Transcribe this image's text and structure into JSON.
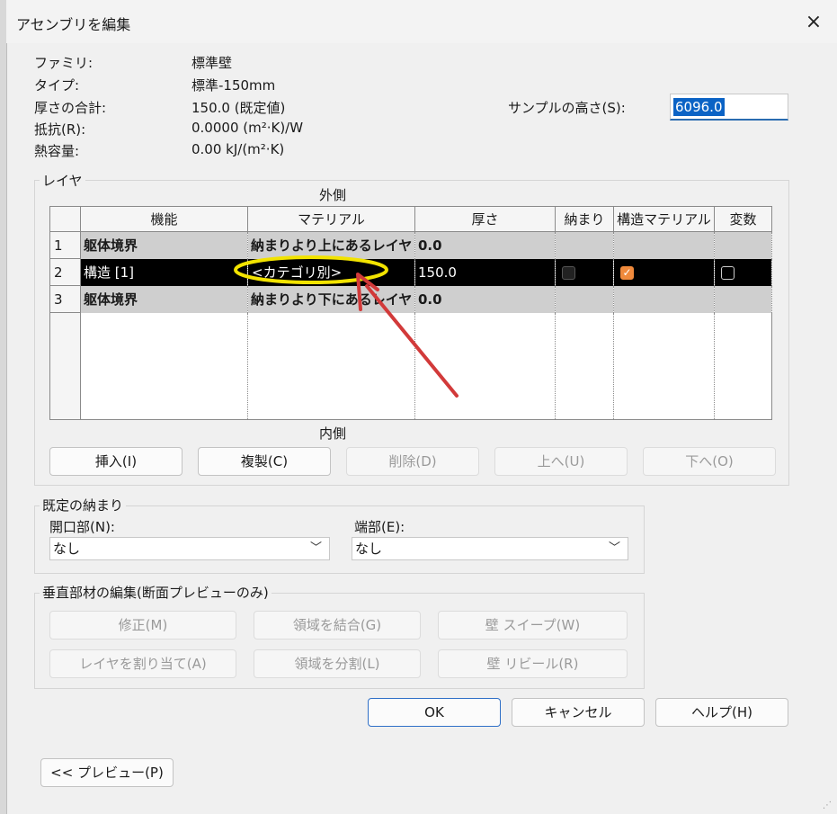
{
  "dialog": {
    "title": "アセンブリを編集",
    "close_icon": "×"
  },
  "info": {
    "family_label": "ファミリ:",
    "family_value": "標準壁",
    "type_label": "タイプ:",
    "type_value": "標準-150mm",
    "thickness_label": "厚さの合計:",
    "thickness_value": "150.0 (既定値)",
    "resistance_label": "抵抗(R):",
    "resistance_value": "0.0000 (m²·K)/W",
    "heat_label": "熱容量:",
    "heat_value": "0.00 kJ/(m²·K)"
  },
  "sample_height": {
    "label": "サンプルの高さ(S):",
    "value": "6096.0"
  },
  "layers": {
    "group_label": "レイヤ",
    "exterior_label": "外側",
    "interior_label": "内側",
    "columns": [
      "機能",
      "マテリアル",
      "厚さ",
      "納まり",
      "構造マテリアル",
      "変数"
    ],
    "rows": [
      {
        "num": "1",
        "function": "躯体境界",
        "material": "納まりより上にあるレイヤ",
        "thickness": "0.0"
      },
      {
        "num": "2",
        "function": "構造 [1]",
        "material": "<カテゴリ別>",
        "thickness": "150.0",
        "wrap": false,
        "structural": true,
        "variable": false
      },
      {
        "num": "3",
        "function": "躯体境界",
        "material": "納まりより下にあるレイヤ",
        "thickness": "0.0"
      }
    ],
    "buttons": {
      "insert": "挿入(I)",
      "duplicate": "複製(C)",
      "delete": "削除(D)",
      "up": "上へ(U)",
      "down": "下へ(O)"
    }
  },
  "default_wrapping": {
    "group_label": "既定の納まり",
    "openings_label": "開口部(N):",
    "openings_value": "なし",
    "ends_label": "端部(E):",
    "ends_value": "なし"
  },
  "vertical_edit": {
    "group_label": "垂直部材の編集(断面プレビューのみ)",
    "modify": "修正(M)",
    "merge": "領域を結合(G)",
    "sweeps": "壁 スイープ(W)",
    "assign": "レイヤを割り当て(A)",
    "split": "領域を分割(L)",
    "reveals": "壁 リビール(R)"
  },
  "footer": {
    "ok": "OK",
    "cancel": "キャンセル",
    "help": "ヘルプ(H)",
    "preview": "<< プレビュー(P)"
  },
  "colors": {
    "annotation_ellipse": "#f2e300",
    "annotation_arrow": "#d23a3a",
    "checkbox_on": "#f08a3c",
    "selection": "#000000"
  }
}
